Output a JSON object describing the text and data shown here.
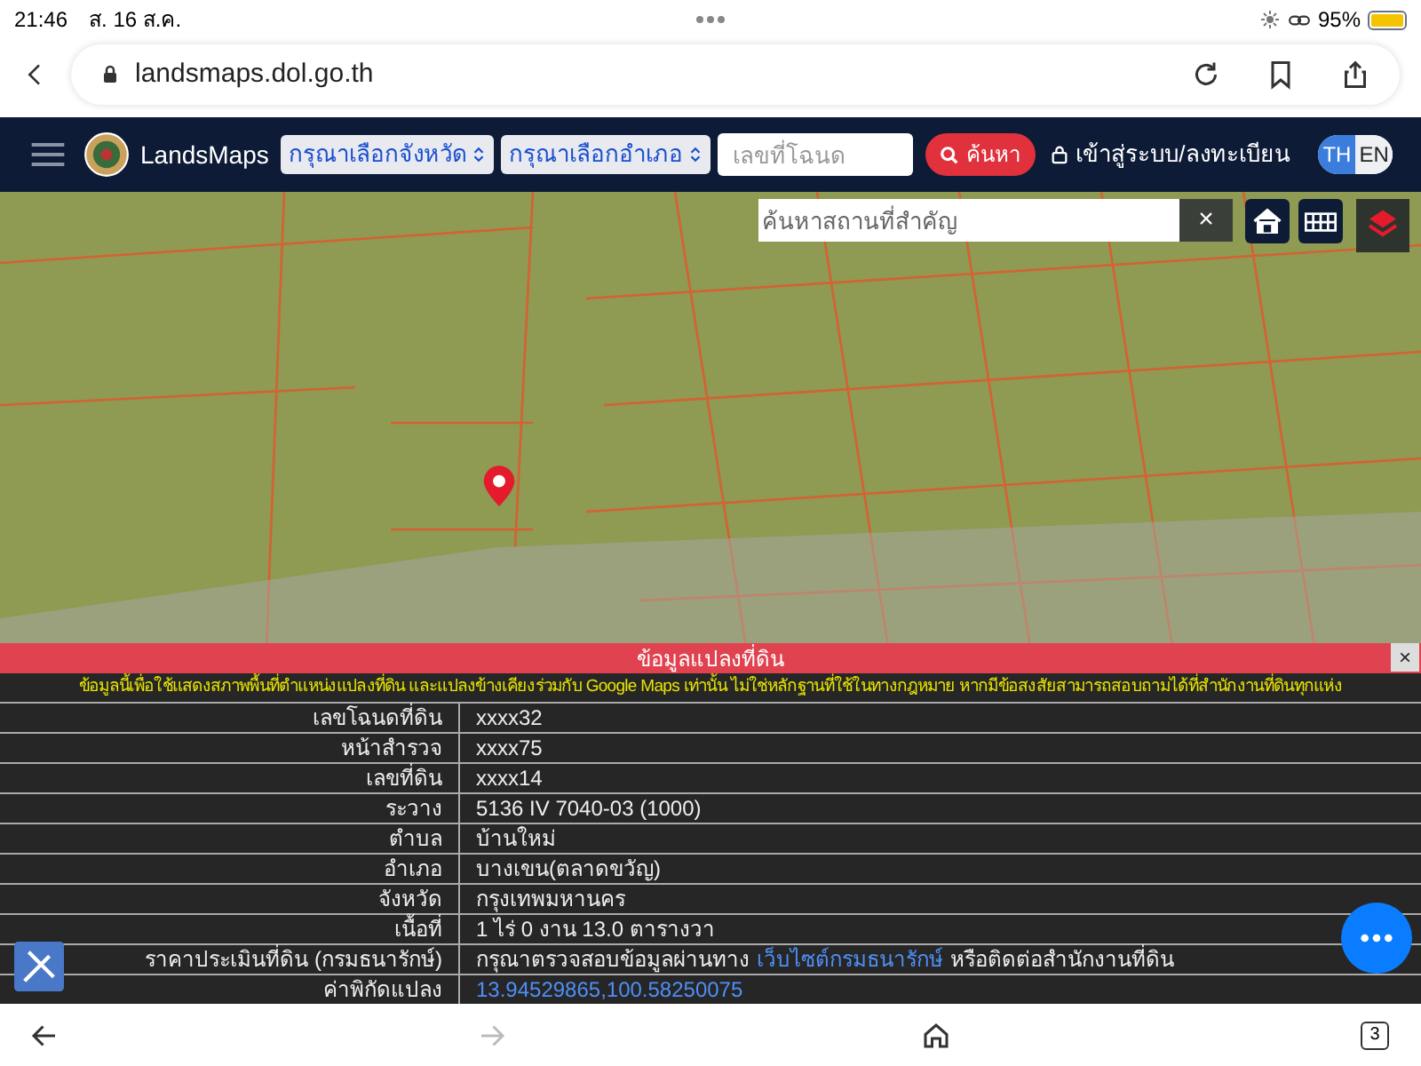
{
  "status_bar": {
    "time": "21:46",
    "date": "ส. 16 ส.ค.",
    "battery": "95%"
  },
  "browser": {
    "url": "landsmaps.dol.go.th",
    "tab_count": "3"
  },
  "navbar": {
    "brand": "LandsMaps",
    "province_select": "กรุณาเลือกจังหวัด",
    "district_select": "กรุณาเลือกอำเภอ",
    "deed_field": {
      "placeholder": "เลขที่โฉนด"
    },
    "search_button": "ค้นหา",
    "login_link": "เข้าสู่ระบบ/ลงทะเบียน",
    "languages": [
      {
        "label": "TH",
        "selected": true
      },
      {
        "label": "EN",
        "selected": false
      }
    ]
  },
  "map": {
    "place_search": {
      "placeholder": "ค้นหาสถานที่สำคัญ"
    },
    "clear_button": "×"
  },
  "parcel_panel": {
    "title": "ข้อมูลแปลงที่ดิน",
    "close_button": "×",
    "notice": "ข้อมูลนี้เพื่อใช้แสดงสภาพพื้นที่ตำแหน่งแปลงที่ดิน และแปลงข้างเคียงร่วมกับ Google Maps เท่านั้น ไม่ใช่หลักฐานที่ใช้ในทางกฎหมาย หากมีข้อสงสัยสามารถสอบถามได้ที่สำนักงานที่ดินทุกแห่ง",
    "rows": [
      {
        "label": "เลขโฉนดที่ดิน",
        "value": "xxxx32"
      },
      {
        "label": "หน้าสำรวจ",
        "value": "xxxx75"
      },
      {
        "label": "เลขที่ดิน",
        "value": "xxxx14"
      },
      {
        "label": "ระวาง",
        "value": "5136 IV 7040-03 (1000)"
      },
      {
        "label": "ตำบล",
        "value": "บ้านใหม่"
      },
      {
        "label": "อำเภอ",
        "value": "บางเขน(ตลาดขวัญ)"
      },
      {
        "label": "จังหวัด",
        "value": "กรุงเทพมหานคร"
      },
      {
        "label": "เนื้อที่",
        "value": "1 ไร่ 0 งาน 13.0 ตารางวา"
      },
      {
        "label": "ราคาประเมินที่ดิน (กรมธนารักษ์)",
        "value": "กรุณาตรวจสอบข้อมูลผ่านทาง",
        "link": "เว็บไซต์กรมธนารักษ์",
        "value_after": "หรือติดต่อสำนักงานที่ดิน"
      },
      {
        "label": "ค่าพิกัดแปลง",
        "link": "13.94529865,100.58250075"
      }
    ]
  }
}
